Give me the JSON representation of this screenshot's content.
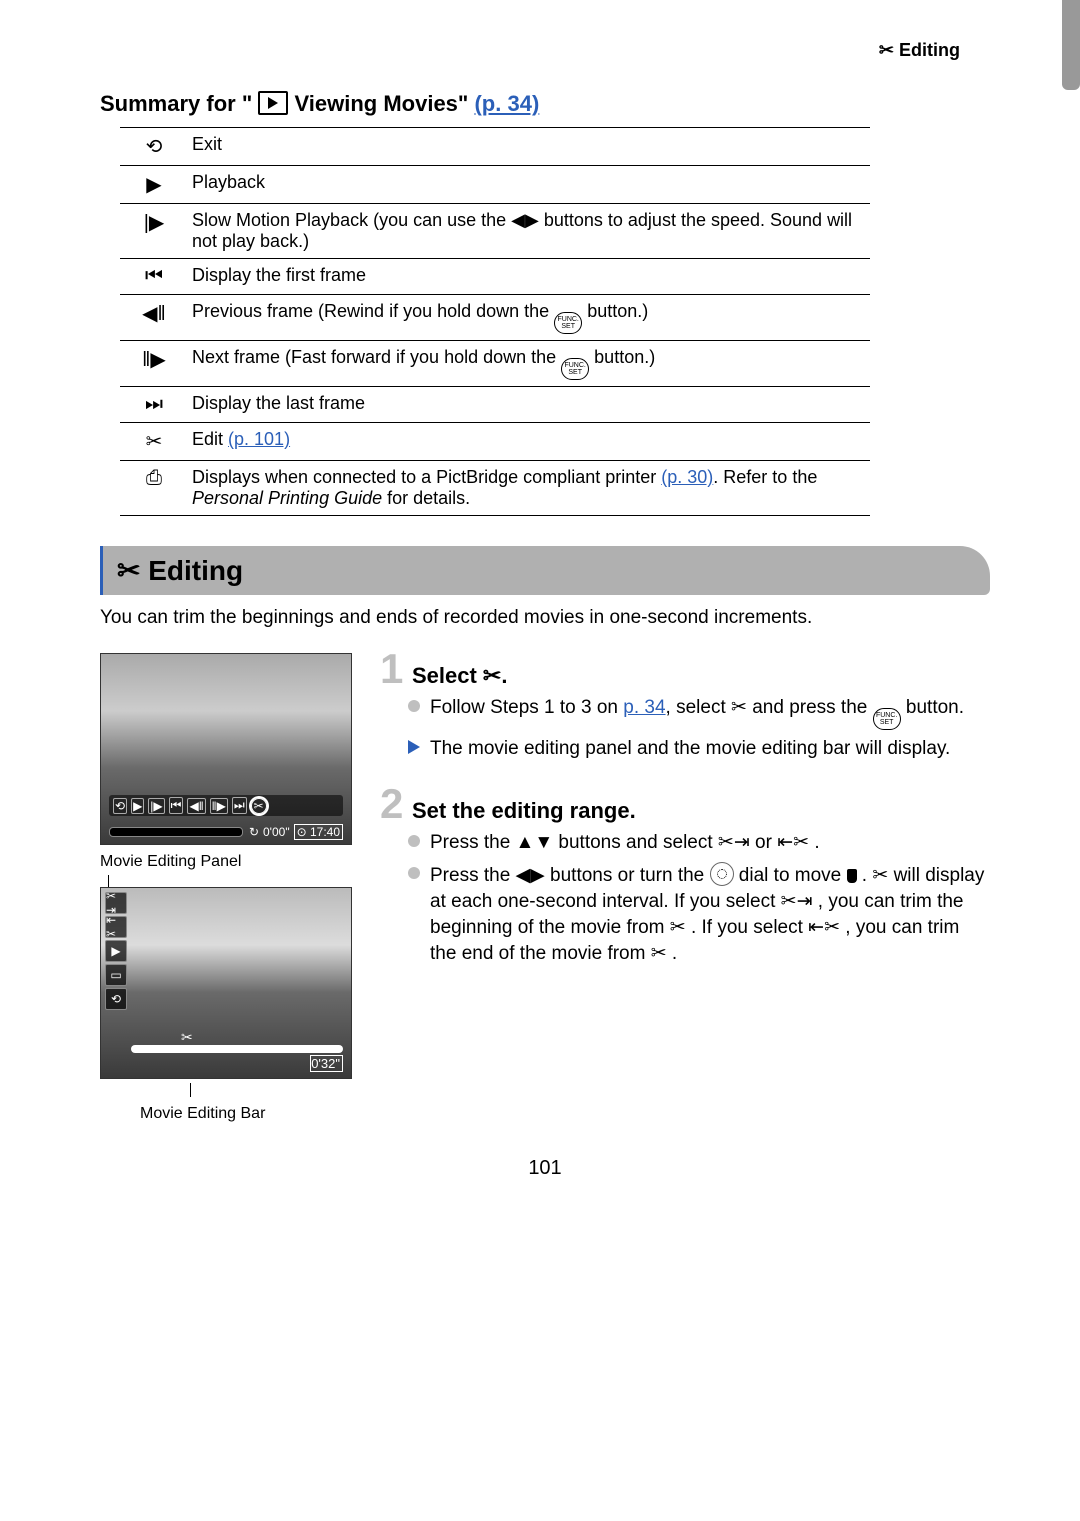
{
  "header": {
    "label": "✂ Editing"
  },
  "summary_title": {
    "prefix": "Summary for \"",
    "text": " Viewing Movies\"",
    "ref": "(p. 34)"
  },
  "table": [
    {
      "icon": "⟲",
      "text": "Exit"
    },
    {
      "icon": "▶",
      "text": "Playback"
    },
    {
      "icon": "|▶",
      "text": "Slow Motion Playback (you can use the ◀▶ buttons to adjust the speed. Sound will not play back.)"
    },
    {
      "icon": "⏮",
      "text": "Display the first frame"
    },
    {
      "icon": "◀‖",
      "text_pre": "Previous frame (Rewind if you hold down the ",
      "text_post": " button.)",
      "has_func": true
    },
    {
      "icon": "‖▶",
      "text_pre": "Next frame (Fast forward if you hold down the ",
      "text_post": " button.)",
      "has_func": true
    },
    {
      "icon": "⏭",
      "text": "Display the last frame"
    },
    {
      "icon": "✂",
      "text_pre": "Edit ",
      "link": "(p. 101)"
    },
    {
      "icon": "⎙",
      "text_pre": "Displays when connected to a PictBridge compliant printer ",
      "link": "(p. 30)",
      "text_post": ". Refer to the ",
      "italic": "Personal Printing Guide",
      "text_tail": " for details."
    }
  ],
  "section": {
    "title": "✂ Editing",
    "intro": "You can trim the beginnings and ends of recorded movies in one-second increments."
  },
  "left": {
    "caption1": "Movie Editing Panel",
    "caption2": "Movie Editing Bar",
    "strip_icons": [
      "⟲",
      "▶",
      "|▶",
      "⏮",
      "◀‖",
      "‖▶",
      "⏭",
      "✂"
    ],
    "time1": "0'00\"",
    "time2": "17:40",
    "panel_icons": [
      "✂⇥",
      "⇤✂",
      "▶",
      "▭",
      "⟲"
    ],
    "edit_time": "0'32\""
  },
  "steps": [
    {
      "num": "1",
      "title": "Select ✂.",
      "bullets": [
        {
          "type": "circle",
          "parts": [
            "Follow Steps 1 to 3 on ",
            {
              "link": "p. 34"
            },
            ", select ✂ and press the ",
            {
              "func": true
            },
            " button."
          ]
        },
        {
          "type": "tri",
          "parts": [
            "The movie editing panel and the movie editing bar will display."
          ]
        }
      ]
    },
    {
      "num": "2",
      "title": "Set the editing range.",
      "bullets": [
        {
          "type": "circle",
          "parts": [
            "Press the ▲▼ buttons and select  ✂⇥  or  ⇤✂ ."
          ]
        },
        {
          "type": "circle",
          "parts": [
            "Press the ◀▶ buttons or turn the ",
            {
              "dial": true
            },
            " dial to move  ",
            {
              "marker": true
            },
            " .  ✂  will display at each one-second interval. If you select  ✂⇥ , you can trim the beginning of the movie from  ✂ . If you select  ⇤✂ , you can trim the end of the movie from  ✂ ."
          ]
        }
      ]
    }
  ],
  "page_number": "101"
}
